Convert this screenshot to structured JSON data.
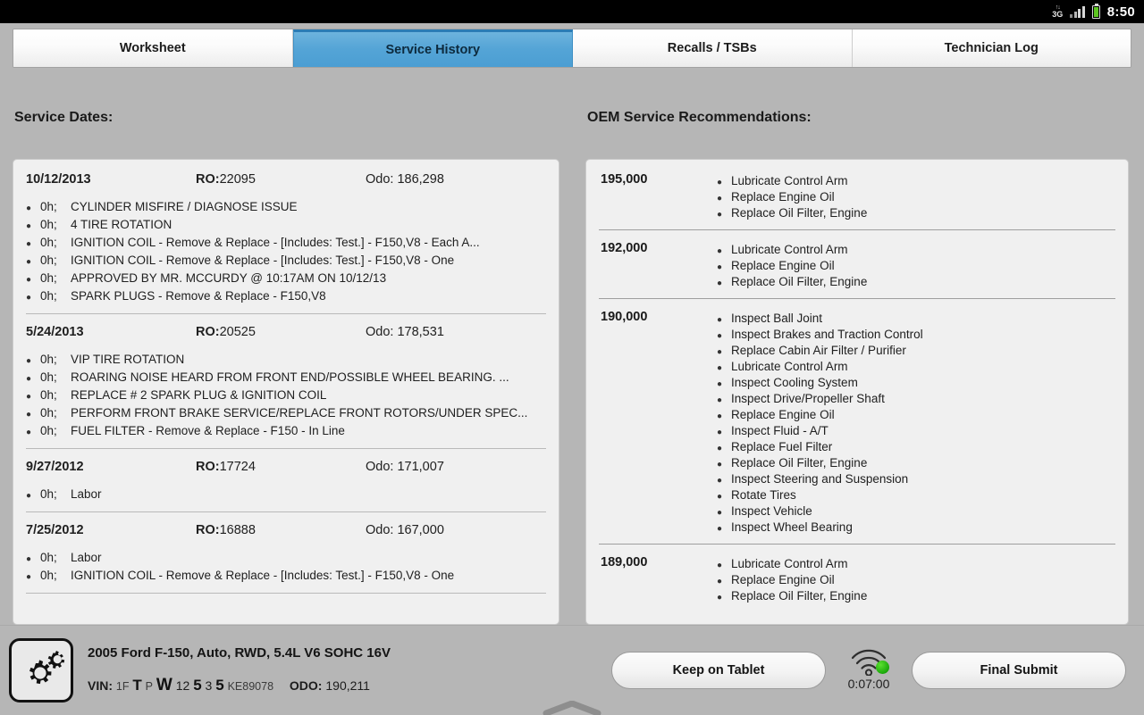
{
  "statusbar": {
    "network": "3G",
    "time": "8:50"
  },
  "tabs": [
    {
      "label": "Worksheet",
      "active": false
    },
    {
      "label": "Service History",
      "active": true
    },
    {
      "label": "Recalls / TSBs",
      "active": false
    },
    {
      "label": "Technician Log",
      "active": false
    }
  ],
  "left": {
    "title": "Service Dates:",
    "blocks": [
      {
        "date": "10/12/2013",
        "ro_label": "RO:",
        "ro": "22095",
        "odo": "Odo: 186,298",
        "lines": [
          {
            "hours": "0h;",
            "desc": "CYLINDER MISFIRE / DIAGNOSE ISSUE"
          },
          {
            "hours": "0h;",
            "desc": "4 TIRE ROTATION"
          },
          {
            "hours": "0h;",
            "desc": "IGNITION COIL - Remove & Replace - [Includes: Test.] - F150,V8 - Each A..."
          },
          {
            "hours": "0h;",
            "desc": "IGNITION COIL - Remove & Replace - [Includes: Test.] - F150,V8 - One"
          },
          {
            "hours": "0h;",
            "desc": "APPROVED BY MR. MCCURDY @ 10:17AM ON 10/12/13"
          },
          {
            "hours": "0h;",
            "desc": "SPARK PLUGS - Remove & Replace - F150,V8"
          }
        ]
      },
      {
        "date": "5/24/2013",
        "ro_label": "RO:",
        "ro": "20525",
        "odo": "Odo: 178,531",
        "lines": [
          {
            "hours": "0h;",
            "desc": "VIP TIRE ROTATION"
          },
          {
            "hours": "0h;",
            "desc": "ROARING NOISE HEARD FROM FRONT END/POSSIBLE WHEEL BEARING. ..."
          },
          {
            "hours": "0h;",
            "desc": "REPLACE # 2 SPARK PLUG & IGNITION COIL"
          },
          {
            "hours": "0h;",
            "desc": "PERFORM FRONT BRAKE SERVICE/REPLACE FRONT ROTORS/UNDER SPEC..."
          },
          {
            "hours": "0h;",
            "desc": "FUEL FILTER - Remove & Replace - F150 - In Line"
          }
        ]
      },
      {
        "date": "9/27/2012",
        "ro_label": "RO:",
        "ro": "17724",
        "odo": "Odo: 171,007",
        "lines": [
          {
            "hours": "0h;",
            "desc": "Labor"
          }
        ]
      },
      {
        "date": "7/25/2012",
        "ro_label": "RO:",
        "ro": "16888",
        "odo": "Odo: 167,000",
        "lines": [
          {
            "hours": "0h;",
            "desc": "Labor"
          },
          {
            "hours": "0h;",
            "desc": "IGNITION COIL - Remove & Replace - [Includes: Test.] - F150,V8 - One"
          }
        ]
      }
    ]
  },
  "right": {
    "title": "OEM Service Recommendations:",
    "blocks": [
      {
        "mileage": "195,000",
        "items": [
          "Lubricate Control Arm",
          "Replace Engine Oil",
          "Replace Oil Filter, Engine"
        ]
      },
      {
        "mileage": "192,000",
        "items": [
          "Lubricate Control Arm",
          "Replace Engine Oil",
          "Replace Oil Filter, Engine"
        ]
      },
      {
        "mileage": "190,000",
        "items": [
          "Inspect Ball Joint",
          "Inspect Brakes and Traction Control",
          "Replace Cabin Air Filter / Purifier",
          "Lubricate Control Arm",
          "Inspect Cooling System",
          "Inspect Drive/Propeller Shaft",
          "Replace Engine Oil",
          "Inspect Fluid - A/T",
          "Replace Fuel Filter",
          "Replace Oil Filter, Engine",
          "Inspect Steering and Suspension",
          "Rotate Tires",
          "Inspect Vehicle",
          "Inspect Wheel Bearing"
        ]
      },
      {
        "mileage": "189,000",
        "items": [
          "Lubricate Control Arm",
          "Replace Engine Oil",
          "Replace Oil Filter, Engine"
        ]
      }
    ]
  },
  "bottom": {
    "vehicle": "2005 Ford F-150, Auto, RWD, 5.4L V6 SOHC 16V",
    "vin_label": "VIN:",
    "vin_parts": [
      {
        "text": "1F",
        "emphasis": "s"
      },
      {
        "text": "T",
        "emphasis": "l"
      },
      {
        "text": "P",
        "emphasis": "s"
      },
      {
        "text": "W",
        "emphasis": "xl"
      },
      {
        "text": "12",
        "emphasis": "m"
      },
      {
        "text": "5",
        "emphasis": "l"
      },
      {
        "text": "3",
        "emphasis": "m"
      },
      {
        "text": "5",
        "emphasis": "l"
      },
      {
        "text": "KE89078",
        "emphasis": "s"
      }
    ],
    "odo_label": "ODO:",
    "odo_value": "190,211",
    "keep_button": "Keep on Tablet",
    "submit_button": "Final Submit",
    "timer": "0:07:00",
    "wifi_status_color": "#1aa80a"
  }
}
